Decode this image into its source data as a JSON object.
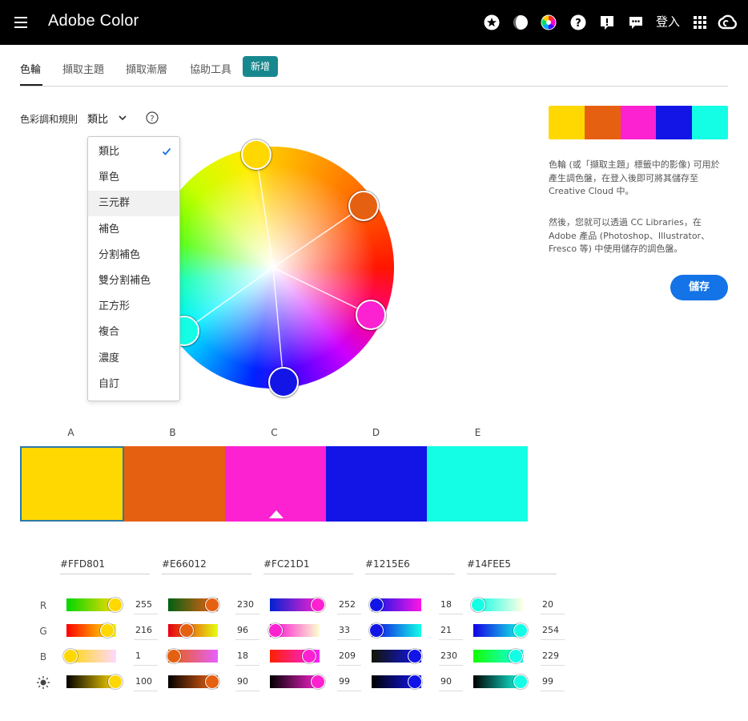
{
  "app": {
    "title": "Adobe Color",
    "login": "登入"
  },
  "topbar": {
    "icons": [
      "star-icon",
      "contrast-icon",
      "color-wheel-icon",
      "help-icon",
      "feedback-icon",
      "chat-icon",
      "apps-grid-icon",
      "creative-cloud-icon"
    ]
  },
  "tabs": [
    {
      "label": "色輪",
      "active": true
    },
    {
      "label": "擷取主題",
      "active": false
    },
    {
      "label": "擷取漸層",
      "active": false
    },
    {
      "label": "協助工具",
      "active": false
    }
  ],
  "tab_new": "新增",
  "rule": {
    "label": "色彩調和規則",
    "value": "類比"
  },
  "dropdown": {
    "items": [
      "類比",
      "單色",
      "三元群",
      "補色",
      "分割補色",
      "雙分割補色",
      "正方形",
      "複合",
      "濃度",
      "自訂"
    ],
    "selected": "類比",
    "hovered": "三元群"
  },
  "description": {
    "p1": "色輪 (或「擷取主題」標籤中的影像) 可用於產生調色盤，在登入後即可將其儲存至 Creative Cloud 中。",
    "p2": "然後，您就可以透過 CC Libraries，在 Adobe 產品 (Photoshop、Illustrator、Fresco 等) 中使用儲存的調色盤。"
  },
  "save_label": "儲存",
  "channel_labels": {
    "r": "R",
    "g": "G",
    "b": "B"
  },
  "swatches": [
    {
      "label": "A",
      "hex": "#FFD801",
      "color": "#FFD801",
      "r": "255",
      "g": "216",
      "b": "1",
      "brightness": "100",
      "active": true
    },
    {
      "label": "B",
      "hex": "#E66012",
      "color": "#E66012",
      "r": "230",
      "g": "96",
      "b": "18",
      "brightness": "90",
      "active": false
    },
    {
      "label": "C",
      "hex": "#FC21D1",
      "color": "#FC21D1",
      "r": "252",
      "g": "33",
      "b": "209",
      "brightness": "99",
      "active": false
    },
    {
      "label": "D",
      "hex": "#1215E6",
      "color": "#1215E6",
      "r": "18",
      "g": "21",
      "b": "230",
      "brightness": "90",
      "active": false
    },
    {
      "label": "E",
      "hex": "#14FEE5",
      "color": "#14FEE5",
      "r": "20",
      "g": "254",
      "b": "229",
      "brightness": "99",
      "active": false
    }
  ]
}
